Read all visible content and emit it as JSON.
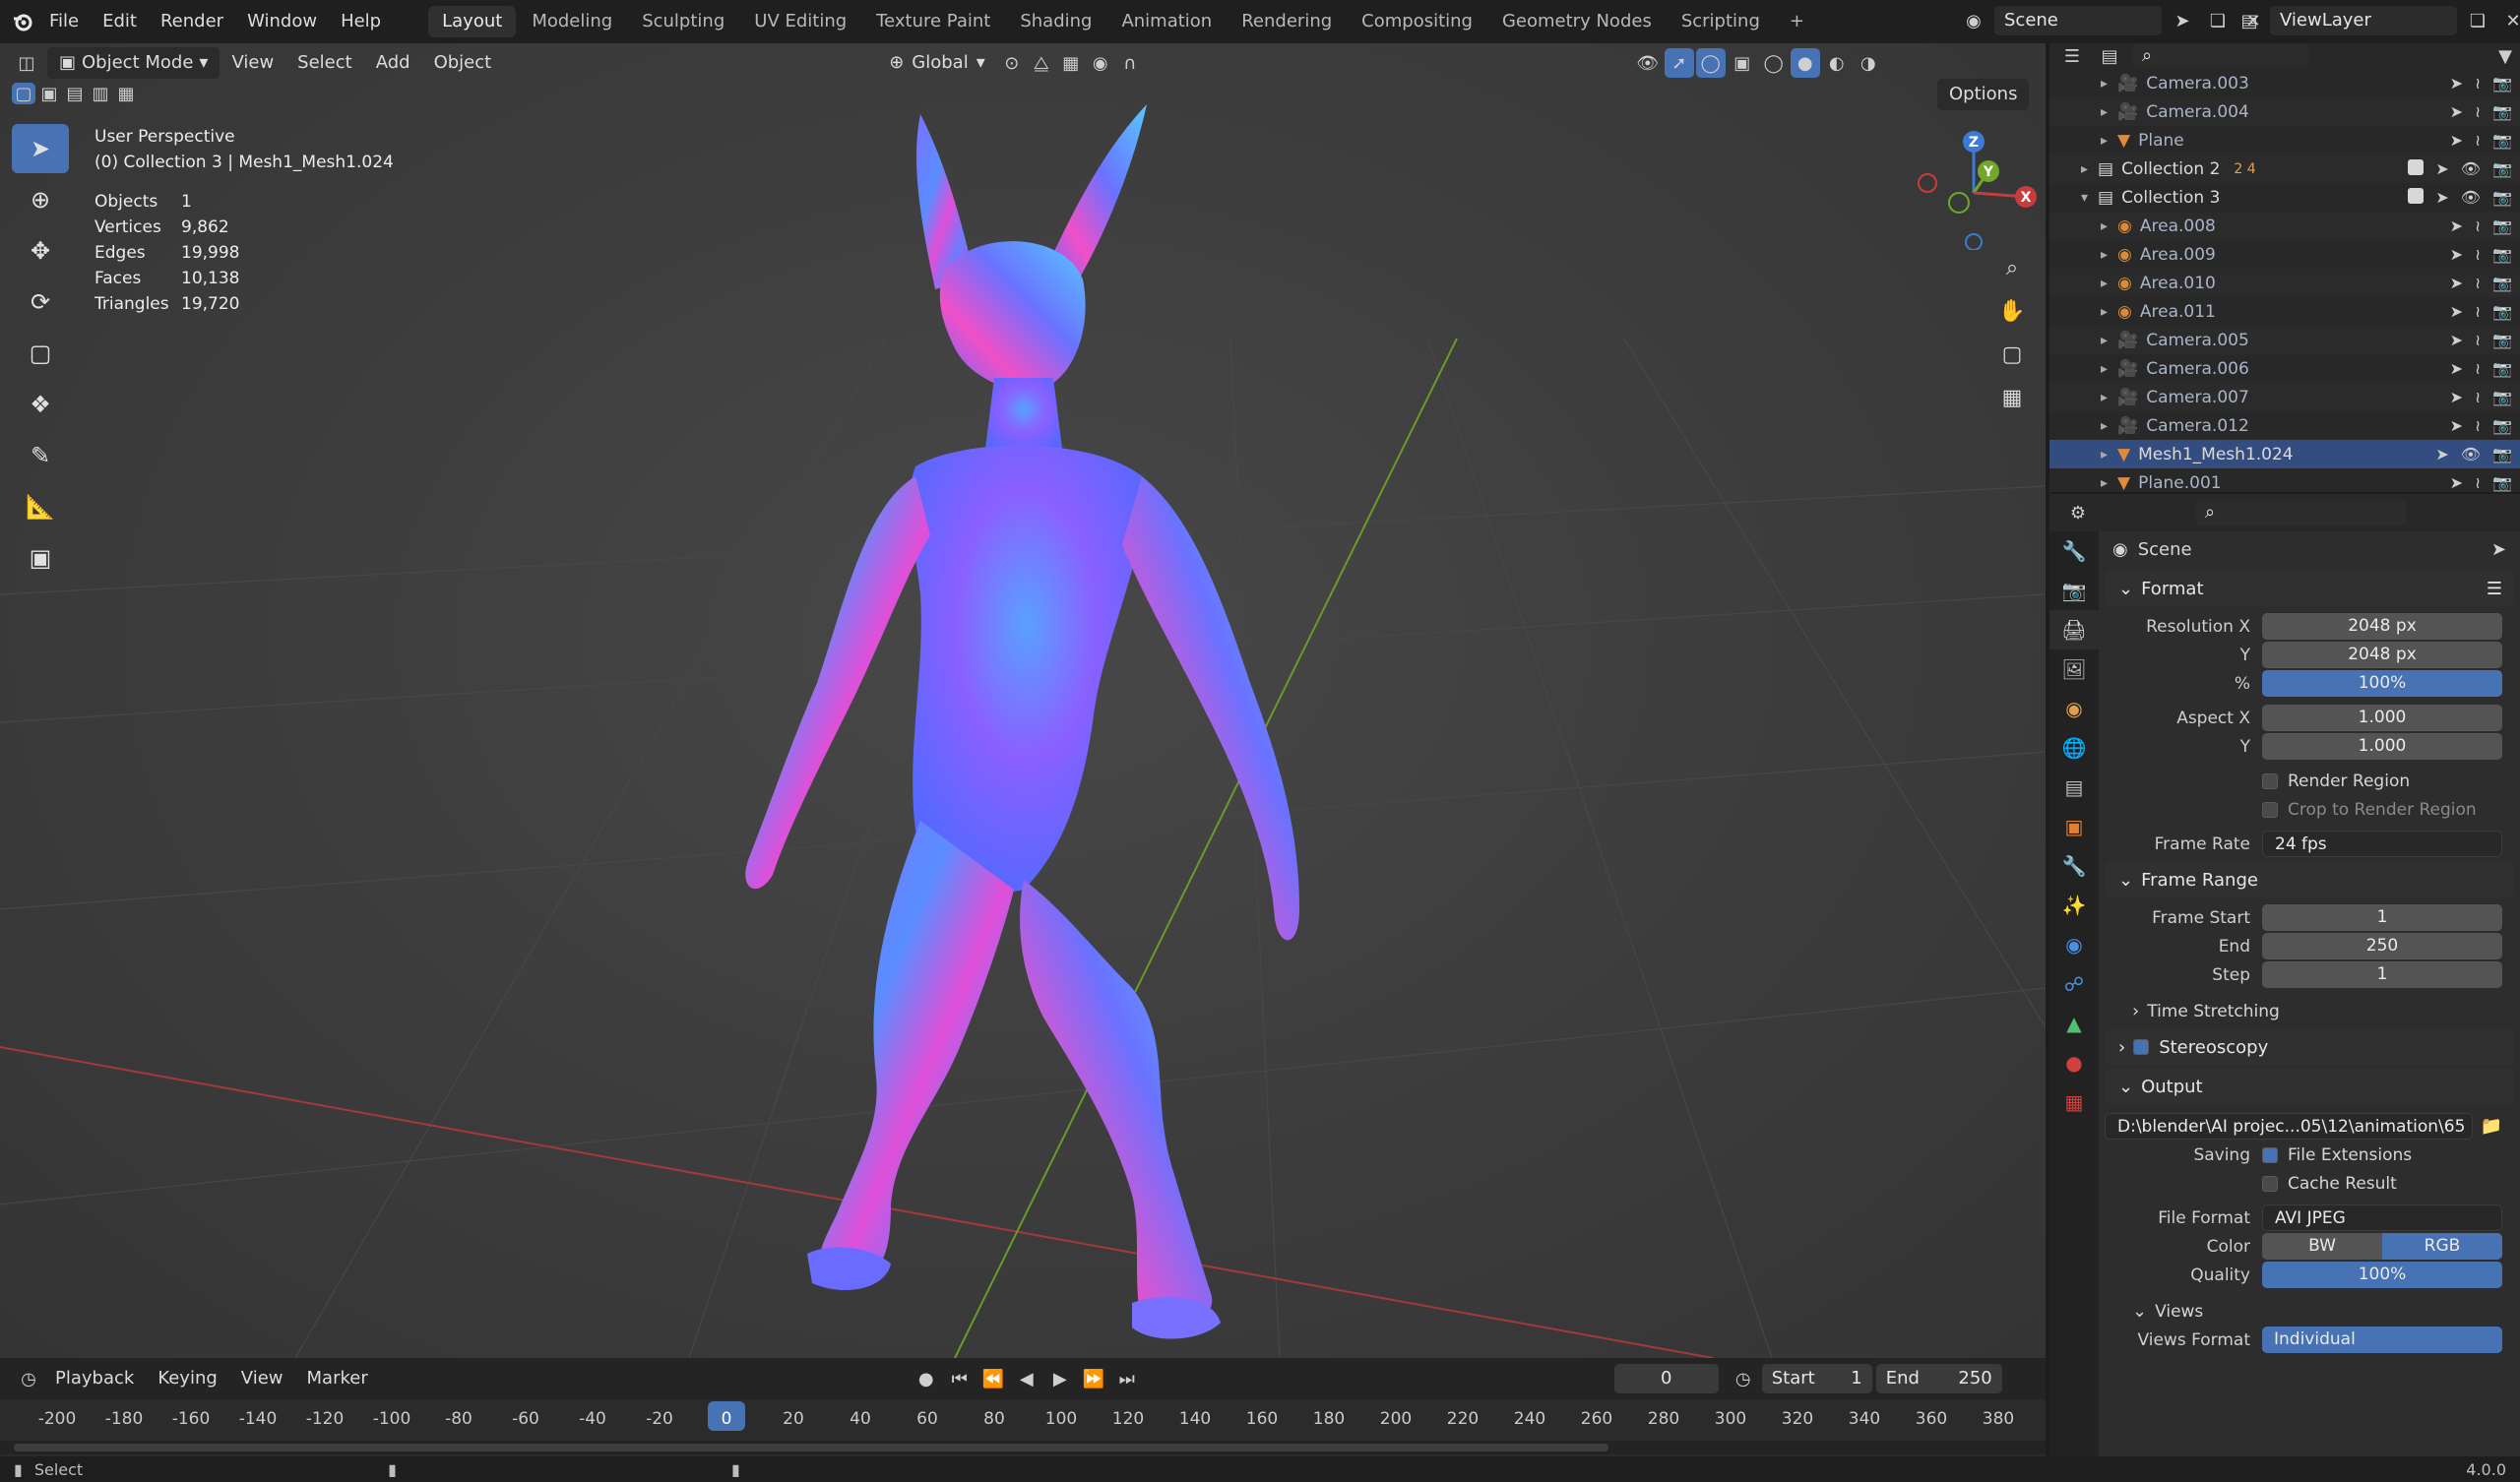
{
  "topbar": {
    "menus": [
      "File",
      "Edit",
      "Render",
      "Window",
      "Help"
    ],
    "workspaces": [
      "Layout",
      "Modeling",
      "Sculpting",
      "UV Editing",
      "Texture Paint",
      "Shading",
      "Animation",
      "Rendering",
      "Compositing",
      "Geometry Nodes",
      "Scripting"
    ],
    "active_workspace": "Layout",
    "add_tab": "+",
    "scene": "Scene",
    "view_layer": "ViewLayer"
  },
  "viewport": {
    "mode": "Object Mode",
    "menus": [
      "View",
      "Select",
      "Add",
      "Object"
    ],
    "orientation": "Global",
    "options_label": "Options",
    "view_name": "User Perspective",
    "collection_info": "(0) Collection 3 | Mesh1_Mesh1.024",
    "stats": [
      {
        "label": "Objects",
        "value": "1"
      },
      {
        "label": "Vertices",
        "value": "9,862"
      },
      {
        "label": "Edges",
        "value": "19,998"
      },
      {
        "label": "Faces",
        "value": "10,138"
      },
      {
        "label": "Triangles",
        "value": "19,720"
      }
    ],
    "gizmo_axes": {
      "z": "Z",
      "y": "Y",
      "x": "X"
    }
  },
  "outliner": {
    "rows": [
      {
        "name": "Camera.003",
        "kind": "camera",
        "indent": 2
      },
      {
        "name": "Camera.004",
        "kind": "camera",
        "indent": 2
      },
      {
        "name": "Plane",
        "kind": "mesh",
        "indent": 2
      },
      {
        "name": "Collection 2",
        "kind": "collection",
        "indent": 1,
        "badges": "2  4"
      },
      {
        "name": "Collection 3",
        "kind": "collection",
        "indent": 1
      },
      {
        "name": "Area.008",
        "kind": "light",
        "indent": 2
      },
      {
        "name": "Area.009",
        "kind": "light",
        "indent": 2
      },
      {
        "name": "Area.010",
        "kind": "light",
        "indent": 2
      },
      {
        "name": "Area.011",
        "kind": "light",
        "indent": 2
      },
      {
        "name": "Camera.005",
        "kind": "camera",
        "indent": 2
      },
      {
        "name": "Camera.006",
        "kind": "camera",
        "indent": 2
      },
      {
        "name": "Camera.007",
        "kind": "camera",
        "indent": 2
      },
      {
        "name": "Camera.012",
        "kind": "camera",
        "indent": 2
      },
      {
        "name": "Mesh1_Mesh1.024",
        "kind": "mesh",
        "indent": 2,
        "selected": true
      },
      {
        "name": "Plane.001",
        "kind": "mesh",
        "indent": 2
      }
    ]
  },
  "properties": {
    "context": "Scene",
    "format_title": "Format",
    "resolution_x_label": "Resolution X",
    "resolution_x": "2048 px",
    "resolution_y_label": "Y",
    "resolution_y": "2048 px",
    "percent_label": "%",
    "percent": "100%",
    "aspect_x_label": "Aspect X",
    "aspect_x": "1.000",
    "aspect_y_label": "Y",
    "aspect_y": "1.000",
    "render_region": "Render Region",
    "crop_region": "Crop to Render Region",
    "frame_rate_label": "Frame Rate",
    "frame_rate": "24 fps",
    "frame_range_title": "Frame Range",
    "frame_start_label": "Frame Start",
    "frame_start": "1",
    "end_label": "End",
    "end": "250",
    "step_label": "Step",
    "step": "1",
    "time_stretching": "Time Stretching",
    "stereoscopy": "Stereoscopy",
    "output_title": "Output",
    "output_path": "D:\\blender\\AI projec...05\\12\\animation\\65",
    "saving_label": "Saving",
    "file_extensions": "File Extensions",
    "cache_result": "Cache Result",
    "file_format_label": "File Format",
    "file_format": "AVI JPEG",
    "color_label": "Color",
    "color_bw": "BW",
    "color_rgb": "RGB",
    "quality_label": "Quality",
    "quality": "100%",
    "views_title": "Views",
    "views_format_label": "Views Format",
    "views_format": "Individual"
  },
  "timeline": {
    "menus": [
      "Playback",
      "Keying",
      "View",
      "Marker"
    ],
    "current_frame": "0",
    "start_label": "Start",
    "start": "1",
    "end_label": "End",
    "end": "250",
    "ticks": [
      "-200",
      "-180",
      "-160",
      "-140",
      "-120",
      "-100",
      "-80",
      "-60",
      "-40",
      "-20",
      "0",
      "20",
      "40",
      "60",
      "80",
      "100",
      "120",
      "140",
      "160",
      "180",
      "200",
      "220",
      "240",
      "260",
      "280",
      "300",
      "320",
      "340",
      "360",
      "380"
    ]
  },
  "statusbar": {
    "left": "Select",
    "version": "4.0.0"
  },
  "colors": {
    "accent": "#4772b3",
    "selected_row": "#334d80",
    "x_axis": "#c83c3c",
    "y_axis": "#6fa82a",
    "z_axis": "#3c7ad6"
  }
}
